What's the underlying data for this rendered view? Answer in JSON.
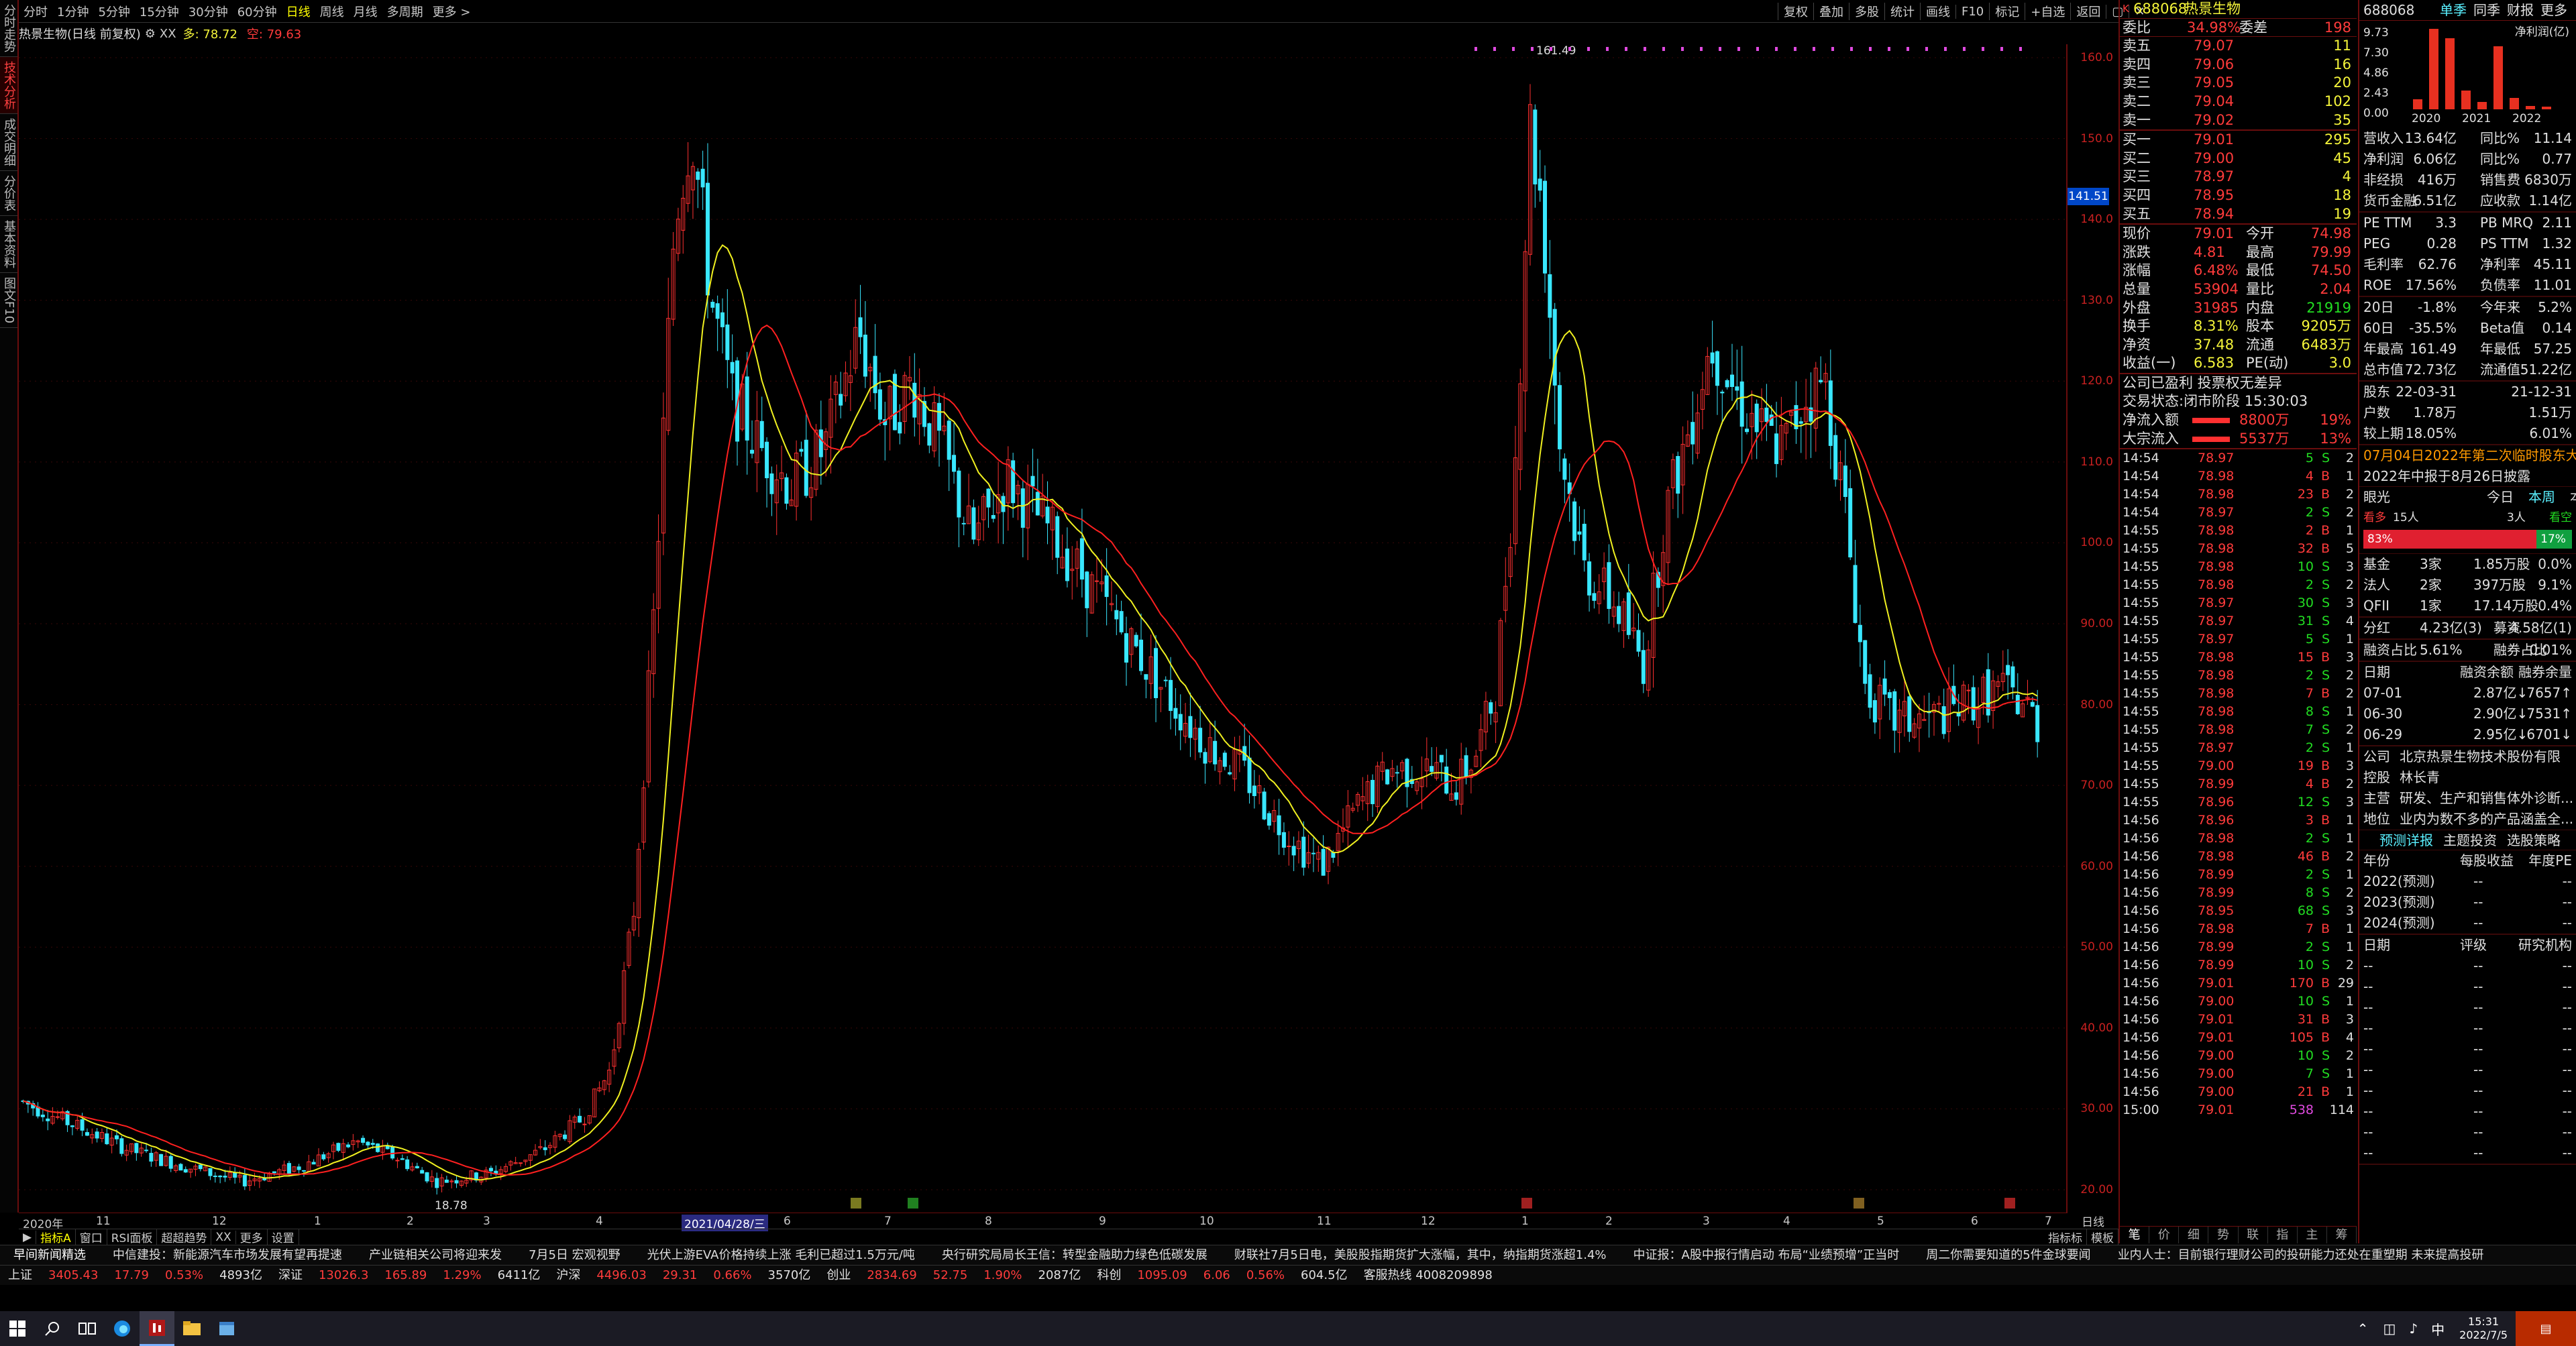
{
  "sidetabs": [
    "分时走势",
    "技术分析",
    "成交明细",
    "分价表",
    "基本资料",
    "图文F10"
  ],
  "toolbar": {
    "periods": [
      "分时",
      "1分钟",
      "5分钟",
      "15分钟",
      "30分钟",
      "60分钟",
      "日线",
      "周线",
      "月线",
      "多周期",
      "更多 >"
    ],
    "active": "日线",
    "right": [
      "复权",
      "叠加",
      "多股",
      "统计",
      "画线",
      "F10",
      "标记",
      "+自选",
      "返回"
    ]
  },
  "chart_info": {
    "title": "热景生物(日线 前复权)",
    "ma1_label": "XX",
    "ma2_label": "多: 78.72",
    "ma3_label": "空: 79.63",
    "marker_high": "161.49",
    "marker_low": "18.78",
    "current_price_tag": "141.51"
  },
  "yaxis": [
    "160.0",
    "150.0",
    "140.0",
    "130.0",
    "120.0",
    "110.0",
    "100.0",
    "90.00",
    "80.00",
    "70.00",
    "60.00",
    "50.00",
    "40.00",
    "30.00",
    "20.00"
  ],
  "xaxis": [
    "2020年",
    "11",
    "12",
    "1",
    "2",
    "3",
    "4",
    "2021/04/28/三",
    "6",
    "7",
    "8",
    "9",
    "10",
    "11",
    "12",
    "1",
    "2",
    "3",
    "4",
    "5",
    "6",
    "7"
  ],
  "bottomtabs": [
    "指标A",
    "窗口",
    "RSI面板",
    "超超趋势",
    "XX",
    "更多",
    "设置"
  ],
  "bottom_right": [
    "指标标",
    "模板"
  ],
  "date_btn": "日线",
  "quote": {
    "code": "688068",
    "name": "热景生物",
    "wb_label": "委比",
    "wb_pct": "34.98%",
    "wc_label": "委差",
    "wc": "198",
    "asks": [
      [
        "卖五",
        "79.07",
        "11"
      ],
      [
        "卖四",
        "79.06",
        "16"
      ],
      [
        "卖三",
        "79.05",
        "20"
      ],
      [
        "卖二",
        "79.04",
        "102"
      ],
      [
        "卖一",
        "79.02",
        "35"
      ]
    ],
    "bids": [
      [
        "买一",
        "79.01",
        "295"
      ],
      [
        "买二",
        "79.00",
        "45"
      ],
      [
        "买三",
        "78.97",
        "4"
      ],
      [
        "买四",
        "78.95",
        "18"
      ],
      [
        "买五",
        "78.94",
        "19"
      ]
    ],
    "stats": [
      [
        "现价",
        "79.01",
        "今开",
        "74.98"
      ],
      [
        "涨跌",
        "4.81",
        "最高",
        "79.99"
      ],
      [
        "涨幅",
        "6.48%",
        "最低",
        "74.50"
      ],
      [
        "总量",
        "53904",
        "量比",
        "2.04"
      ],
      [
        "外盘",
        "31985",
        "内盘",
        "21919"
      ],
      [
        "换手",
        "8.31%",
        "股本",
        "9205万"
      ],
      [
        "净资",
        "37.48",
        "流通",
        "6483万"
      ],
      [
        "收益(一)",
        "6.583",
        "PE(动)",
        "3.0"
      ]
    ],
    "status1": "公司已盈利 投票权无差异",
    "status2": "交易状态:闭市阶段 15:30:03",
    "flow": [
      [
        "净流入额",
        "8800万",
        "19%"
      ],
      [
        "大宗流入",
        "5537万",
        "13%"
      ]
    ]
  },
  "ticks": [
    [
      "14:54",
      "78.97",
      "5",
      "S",
      "2"
    ],
    [
      "14:54",
      "78.98",
      "4",
      "B",
      "1"
    ],
    [
      "14:54",
      "78.98",
      "23",
      "B",
      "2"
    ],
    [
      "14:54",
      "78.97",
      "2",
      "S",
      "2"
    ],
    [
      "14:55",
      "78.98",
      "2",
      "B",
      "1"
    ],
    [
      "14:55",
      "78.98",
      "32",
      "B",
      "5"
    ],
    [
      "14:55",
      "78.98",
      "10",
      "S",
      "3"
    ],
    [
      "14:55",
      "78.98",
      "2",
      "S",
      "2"
    ],
    [
      "14:55",
      "78.97",
      "30",
      "S",
      "3"
    ],
    [
      "14:55",
      "78.97",
      "31",
      "S",
      "4"
    ],
    [
      "14:55",
      "78.97",
      "5",
      "S",
      "1"
    ],
    [
      "14:55",
      "78.98",
      "15",
      "B",
      "3"
    ],
    [
      "14:55",
      "78.98",
      "2",
      "S",
      "2"
    ],
    [
      "14:55",
      "78.98",
      "7",
      "B",
      "2"
    ],
    [
      "14:55",
      "78.98",
      "8",
      "S",
      "1"
    ],
    [
      "14:55",
      "78.98",
      "7",
      "S",
      "2"
    ],
    [
      "14:55",
      "78.97",
      "2",
      "S",
      "1"
    ],
    [
      "14:55",
      "79.00",
      "19",
      "B",
      "3"
    ],
    [
      "14:55",
      "78.99",
      "4",
      "B",
      "2"
    ],
    [
      "14:55",
      "78.96",
      "12",
      "S",
      "3"
    ],
    [
      "14:56",
      "78.96",
      "3",
      "B",
      "1"
    ],
    [
      "14:56",
      "78.98",
      "2",
      "S",
      "1"
    ],
    [
      "14:56",
      "78.98",
      "46",
      "B",
      "2"
    ],
    [
      "14:56",
      "78.99",
      "2",
      "S",
      "1"
    ],
    [
      "14:56",
      "78.99",
      "8",
      "S",
      "2"
    ],
    [
      "14:56",
      "78.95",
      "68",
      "S",
      "3"
    ],
    [
      "14:56",
      "78.98",
      "7",
      "B",
      "1"
    ],
    [
      "14:56",
      "78.99",
      "2",
      "S",
      "1"
    ],
    [
      "14:56",
      "78.99",
      "10",
      "S",
      "2"
    ],
    [
      "14:56",
      "79.01",
      "170",
      "B",
      "29"
    ],
    [
      "14:56",
      "79.00",
      "10",
      "S",
      "1"
    ],
    [
      "14:56",
      "79.01",
      "31",
      "B",
      "3"
    ],
    [
      "14:56",
      "79.01",
      "105",
      "B",
      "4"
    ],
    [
      "14:56",
      "79.00",
      "10",
      "S",
      "2"
    ],
    [
      "14:56",
      "79.00",
      "7",
      "S",
      "1"
    ],
    [
      "14:56",
      "79.00",
      "21",
      "B",
      "1"
    ],
    [
      "15:00",
      "79.01",
      "538",
      "",
      "114"
    ]
  ],
  "panel_tabs": [
    "笔",
    "价",
    "细",
    "势",
    "联",
    "指",
    "主",
    "筹"
  ],
  "f10": {
    "code": "688068",
    "tabs": [
      "单季",
      "同季",
      "财报",
      "更多"
    ],
    "bar_chart": {
      "type": "bar",
      "title": "净利润(亿)",
      "categories": [
        "2020",
        "2021",
        "2022"
      ],
      "ylim": [
        0,
        9.73
      ],
      "yticks": [
        "9.73",
        "7.30",
        "4.86",
        "2.43",
        "0.00"
      ],
      "values": [
        1.2,
        9.73,
        8.6,
        2.3,
        0.9,
        7.6,
        1.4,
        0.4,
        0.3
      ]
    },
    "rows1": [
      [
        "营收入",
        "13.64亿",
        "同比%",
        "11.14"
      ],
      [
        "净利润",
        "6.06亿",
        "同比%",
        "0.77"
      ],
      [
        "非经损",
        "416万",
        "销售费",
        "6830万"
      ],
      [
        "货币金融",
        "6.51亿",
        "应收款",
        "1.14亿"
      ]
    ],
    "rows2": [
      [
        "PE TTM",
        "3.3",
        "PB MRQ",
        "2.11"
      ],
      [
        "PEG",
        "0.28",
        "PS TTM",
        "1.32"
      ],
      [
        "毛利率",
        "62.76",
        "净利率",
        "45.11"
      ],
      [
        "ROE",
        "17.56%",
        "负债率",
        "11.01"
      ]
    ],
    "rows3": [
      [
        "20日",
        "-1.8%",
        "今年来",
        "5.2%"
      ],
      [
        "60日",
        "-35.5%",
        "Beta值",
        "0.14"
      ],
      [
        "年最高",
        "161.49",
        "年最低",
        "57.25"
      ],
      [
        "总市值",
        "72.73亿",
        "流通值",
        "51.22亿"
      ]
    ],
    "rows4": [
      [
        "股东",
        "22-03-31",
        "",
        "21-12-31"
      ],
      [
        "户数",
        "1.78万",
        "",
        "1.51万"
      ],
      [
        "较上期",
        "18.05%",
        "",
        "6.01%"
      ]
    ],
    "news1": "07月04日2022年第二次临时股东大会",
    "news2": "2022年中报于8月26日披露",
    "view_label": "眼光",
    "view_tabs": [
      "今日",
      "本周",
      "本年"
    ],
    "bull_label": "看多",
    "bull_count": "15人",
    "bear_count": "3人",
    "bear_label": "看空",
    "bull_pct": "83%",
    "bear_pct": "17%",
    "bull_frac": 0.83,
    "inst": [
      [
        "基金",
        "3家",
        "1.85万股",
        "0.0%"
      ],
      [
        "法人",
        "2家",
        "397万股",
        "9.1%"
      ],
      [
        "QFII",
        "1家",
        "17.14万股",
        "0.4%"
      ]
    ],
    "dividend": [
      "分红",
      "4.23亿(3)",
      "募资",
      "4.58亿(1)"
    ],
    "margin": [
      "融资占比",
      "5.61%",
      "融券占比",
      "0.01%"
    ],
    "margin_head": [
      "日期",
      "融资余额",
      "融券余量"
    ],
    "margin_rows": [
      [
        "07-01",
        "2.87亿↓",
        "7657↑"
      ],
      [
        "06-30",
        "2.90亿↓",
        "7531↑"
      ],
      [
        "06-29",
        "2.95亿↓",
        "6701↓"
      ]
    ],
    "company": [
      [
        "公司",
        "北京热景生物技术股份有限"
      ],
      [
        "控股",
        "林长青"
      ],
      [
        "主营",
        "研发、生产和销售体外诊断..."
      ],
      [
        "地位",
        "业内为数不多的产品涵盖全..."
      ]
    ],
    "links": [
      "预测详报",
      "主题投资",
      "选股策略"
    ],
    "forecast_head": [
      "年份",
      "每股收益",
      "年度PE"
    ],
    "forecast": [
      [
        "2022(预测)",
        "--",
        "--"
      ],
      [
        "2023(预测)",
        "--",
        "--"
      ],
      [
        "2024(预测)",
        "--",
        "--"
      ]
    ],
    "rating_head": [
      "日期",
      "评级",
      "研究机构"
    ],
    "ratings": [
      [
        "--",
        "--",
        "--"
      ],
      [
        "--",
        "--",
        "--"
      ],
      [
        "--",
        "--",
        "--"
      ],
      [
        "--",
        "--",
        "--"
      ],
      [
        "--",
        "--",
        "--"
      ],
      [
        "--",
        "--",
        "--"
      ],
      [
        "--",
        "--",
        "--"
      ],
      [
        "--",
        "--",
        "--"
      ],
      [
        "--",
        "--",
        "--"
      ],
      [
        "--",
        "--",
        "--"
      ]
    ]
  },
  "ticker": [
    "早间新闻精选",
    "中信建投：新能源汽车市场发展有望再提速",
    "产业链相关公司将迎来发",
    "7月5日 宏观视野",
    "光伏上游EVA价格持续上涨 毛利已超过1.5万元/吨",
    "央行研究局局长王信：转型金融助力绿色低碳发展",
    "财联社7月5日电，美股股指期货扩大涨幅，其中，纳指期货涨超1.4%",
    "中证报：A股中报行情启动 布局“业绩预增”正当时",
    "周二你需要知道的5件金球要闻",
    "业内人士：目前银行理财公司的投研能力还处在重塑期 未来提高投研"
  ],
  "index": [
    [
      "上证",
      "3405.43",
      "17.79",
      "0.53%",
      "4893亿"
    ],
    [
      "深证",
      "13026.3",
      "165.89",
      "1.29%",
      "6411亿"
    ],
    [
      "沪深",
      "4496.03",
      "29.31",
      "0.66%",
      "3570亿"
    ],
    [
      "创业",
      "2834.69",
      "52.75",
      "1.90%",
      "2087亿"
    ],
    [
      "科创",
      "1095.09",
      "6.06",
      "0.56%",
      "604.5亿"
    ]
  ],
  "hotline": "客服热线 4008209898",
  "taskbar": {
    "ime": "中",
    "time": "15:31",
    "date": "2022/7/5"
  },
  "colors": {
    "up": "#ff3b3b",
    "down": "#22dd22",
    "candle_up": "#ff3030",
    "candle_down": "#39e7ff",
    "ma_fast": "#f0f020",
    "ma_slow": "#ff2020"
  }
}
